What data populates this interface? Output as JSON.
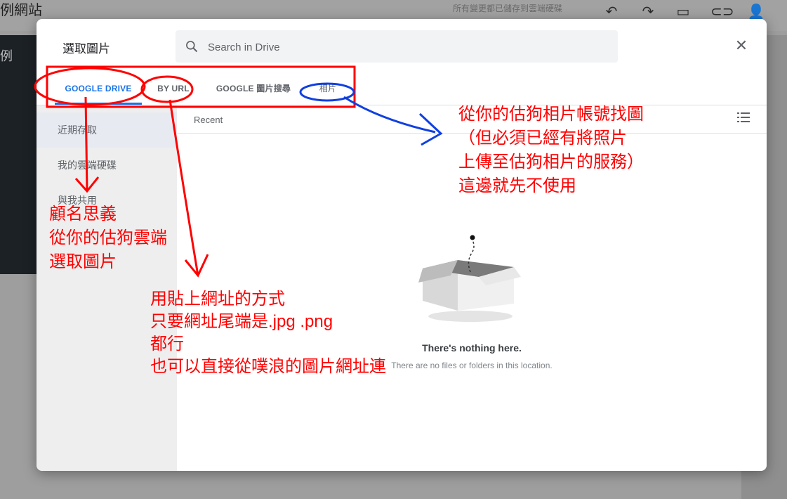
{
  "background": {
    "title": "例網站",
    "saved_status": "所有變更都已儲存到雲端硬碟",
    "sidebar_fragment": "例",
    "toolbar_icons": [
      "undo-icon",
      "redo-icon",
      "preview-icon",
      "link-icon",
      "add-person-icon"
    ]
  },
  "dialog": {
    "title": "選取圖片",
    "search_placeholder": "Search in Drive",
    "tabs": [
      {
        "label": "GOOGLE DRIVE",
        "active": true
      },
      {
        "label": "BY URL",
        "active": false
      },
      {
        "label": "GOOGLE 圖片搜尋",
        "active": false
      },
      {
        "label": "相片",
        "active": false
      }
    ],
    "sidebar_items": [
      {
        "label": "近期存取",
        "active": true
      },
      {
        "label": "我的雲端硬碟",
        "active": false
      },
      {
        "label": "與我共用",
        "active": false
      }
    ],
    "section_label": "Recent",
    "empty_title": "There's nothing here.",
    "empty_subtitle": "There are no files or folders in this location."
  },
  "annotations": {
    "drive_note": [
      "顧名思義",
      "從你的估狗雲端",
      "選取圖片"
    ],
    "url_note": [
      "用貼上網址的方式",
      "只要網址尾端是.jpg .png",
      "都行",
      "也可以直接從噗浪的圖片網址連"
    ],
    "photos_note": [
      "從你的估狗相片帳號找圖",
      "（但必須已經有將照片",
      "上傳至估狗相片的服務）",
      "這邊就先不使用"
    ]
  },
  "colors": {
    "accent": "#1a73e8",
    "annotation_red": "#ff0000",
    "annotation_blue": "#1040e0"
  }
}
